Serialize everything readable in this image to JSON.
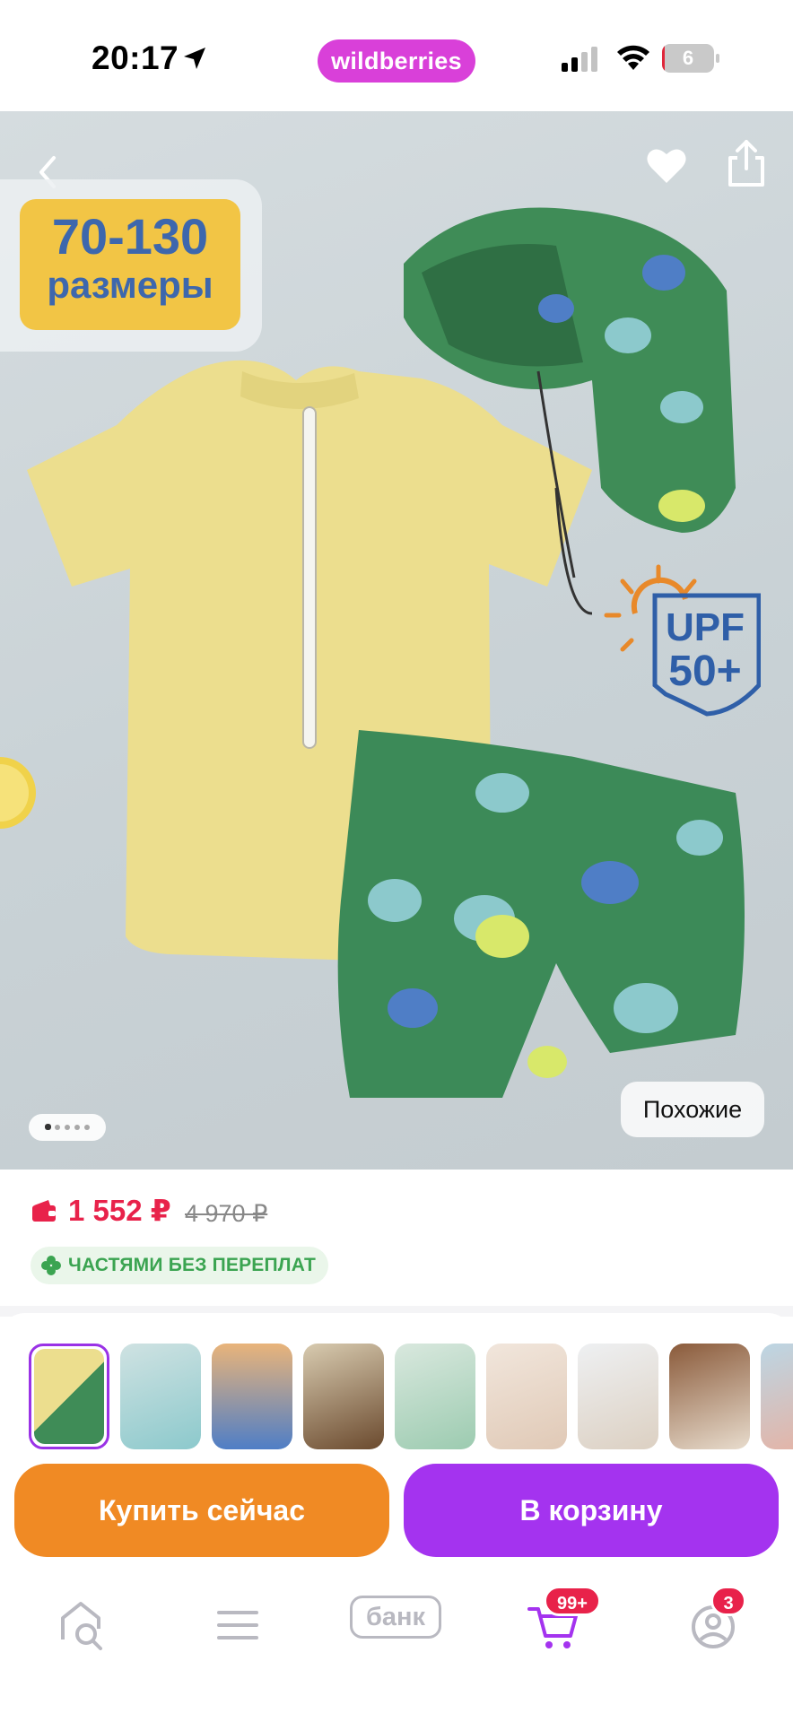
{
  "status_bar": {
    "time": "20:17",
    "brand": "wildberries",
    "battery_level": "6"
  },
  "product": {
    "size_badge_range": "70-130",
    "size_badge_word": "размеры",
    "upf_line1": "UPF",
    "upf_line2": "50+",
    "similar_label": "Похожие",
    "gallery_pages": 5,
    "gallery_current_page": 1
  },
  "pricing": {
    "current": "1 552 ₽",
    "old": "4 970 ₽",
    "installment": "ЧАСТЯМИ БЕЗ ПЕРЕПЛАТ"
  },
  "thumbnails": {
    "selected_index": 0,
    "count_visible": 9
  },
  "actions": {
    "buy_now": "Купить сейчас",
    "add_to_cart": "В корзину"
  },
  "tab_bar": {
    "bank_label": "банк",
    "cart_badge": "99+",
    "profile_badge": "3"
  },
  "colors": {
    "brand": "#d940d9",
    "price": "#e8224a",
    "installment": "#3ba451",
    "buy_now": "#f08a24",
    "add_to_cart": "#a433ef",
    "thumb_selected": "#9a32e6"
  }
}
